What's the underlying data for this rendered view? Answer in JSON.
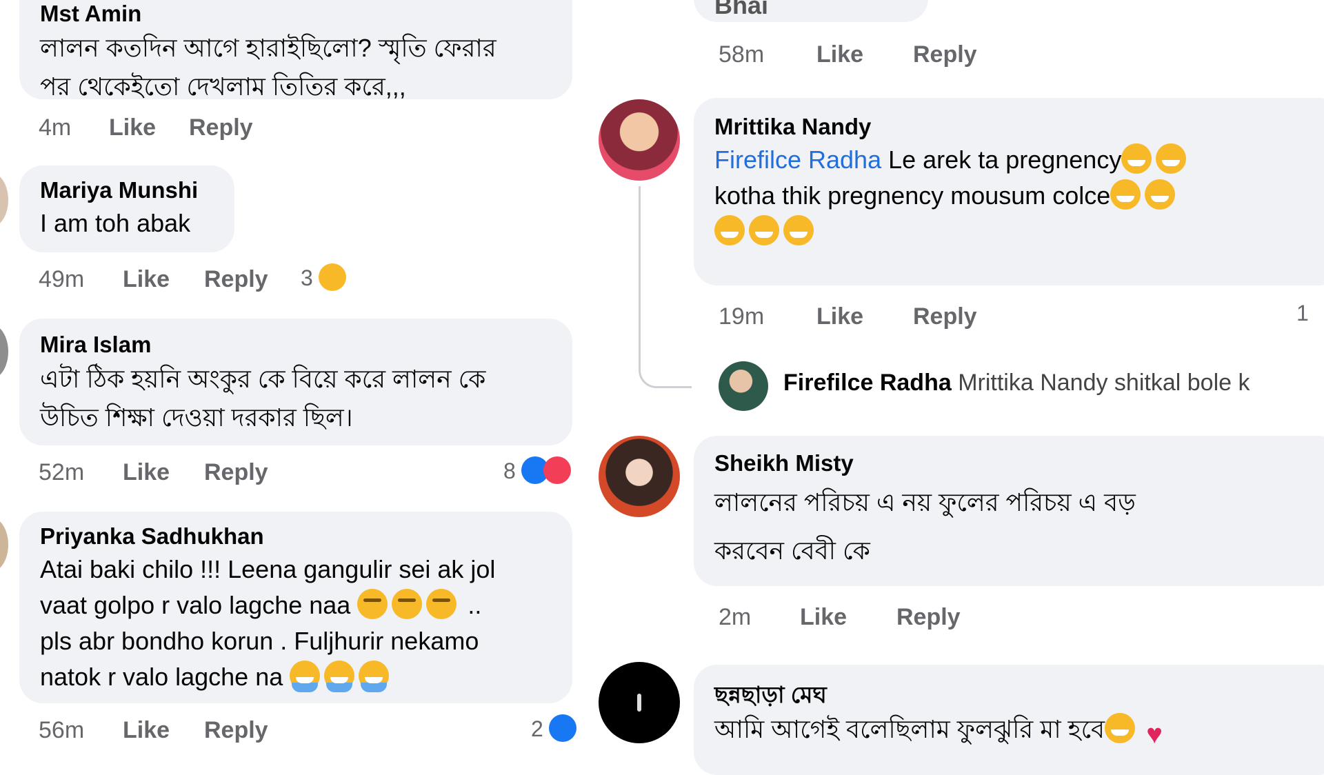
{
  "left": {
    "top_partial": {
      "author": "Mst Amin",
      "actions": {
        "time": "",
        "like": "Like",
        "reply": "Reply"
      }
    },
    "comments": [
      {
        "author": "",
        "lines": [
          "লালন কতদিন আগে হারাইছিলো? স্মৃতি ফেরার",
          "পর থেকেইতো দেখলাম তিতির করে,,,"
        ],
        "time": "4m",
        "like": "Like",
        "reply": "Reply"
      },
      {
        "author": "Mariya Munshi",
        "lines": [
          "I am toh abak"
        ],
        "time": "49m",
        "like": "Like",
        "reply": "Reply",
        "reactions": {
          "count": "3",
          "icon": "haha-reaction-icon"
        }
      },
      {
        "author": "Mira Islam",
        "lines": [
          "এটা ঠিক হয়নি অংকুর কে বিয়ে করে লালন কে",
          "উচিত  শিক্ষা দেওয়া দরকার ছিল।"
        ],
        "time": "52m",
        "like": "Like",
        "reply": "Reply",
        "reactions": {
          "count": "8",
          "icon": "like-love-reaction-icons"
        }
      },
      {
        "author": "Priyanka Sadhukhan",
        "lines": [
          "Atai baki chilo !!! Leena gangulir sei ak jol",
          "vaat  golpo r valo lagche naa",
          "pls abr bondho korun . Fuljhurir nekamo",
          "natok r valo lagche na"
        ],
        "line_suffixes": [
          "",
          " ..",
          "",
          ""
        ],
        "time": "56m",
        "like": "Like",
        "reply": "Reply",
        "reactions": {
          "count": "2",
          "icon": "like-reaction-icon"
        }
      }
    ]
  },
  "right": {
    "top_partial": {
      "text": "Bhai",
      "time": "58m",
      "like": "Like",
      "reply": "Reply"
    },
    "comments": [
      {
        "author": "Mrittika Nandy",
        "mention": "Firefilce Radha",
        "lines": [
          " Le arek ta pregnency",
          "kotha thik pregnency mousum colce",
          ""
        ],
        "time": "19m",
        "like": "Like",
        "reply": "Reply",
        "reactions": {
          "count": "1"
        },
        "reply_preview": {
          "author": "Firefilce Radha",
          "text": "Mrittika Nandy shitkal bole k"
        }
      },
      {
        "author": "Sheikh Misty",
        "lines": [
          "লালনের পরিচয় এ নয় ফুলের পরিচয় এ বড়",
          "করবেন বেবী কে"
        ],
        "time": "2m",
        "like": "Like",
        "reply": "Reply"
      },
      {
        "author": "ছন্নছাড়া মেঘ",
        "lines": [
          "আমি আগেই বলেছিলাম ফুলঝুরি মা হবে"
        ]
      }
    ]
  },
  "colors": {
    "bubble": "#f0f2f5",
    "meta": "#65676b",
    "mention": "#216fdb",
    "like_blue": "#1877f2"
  }
}
